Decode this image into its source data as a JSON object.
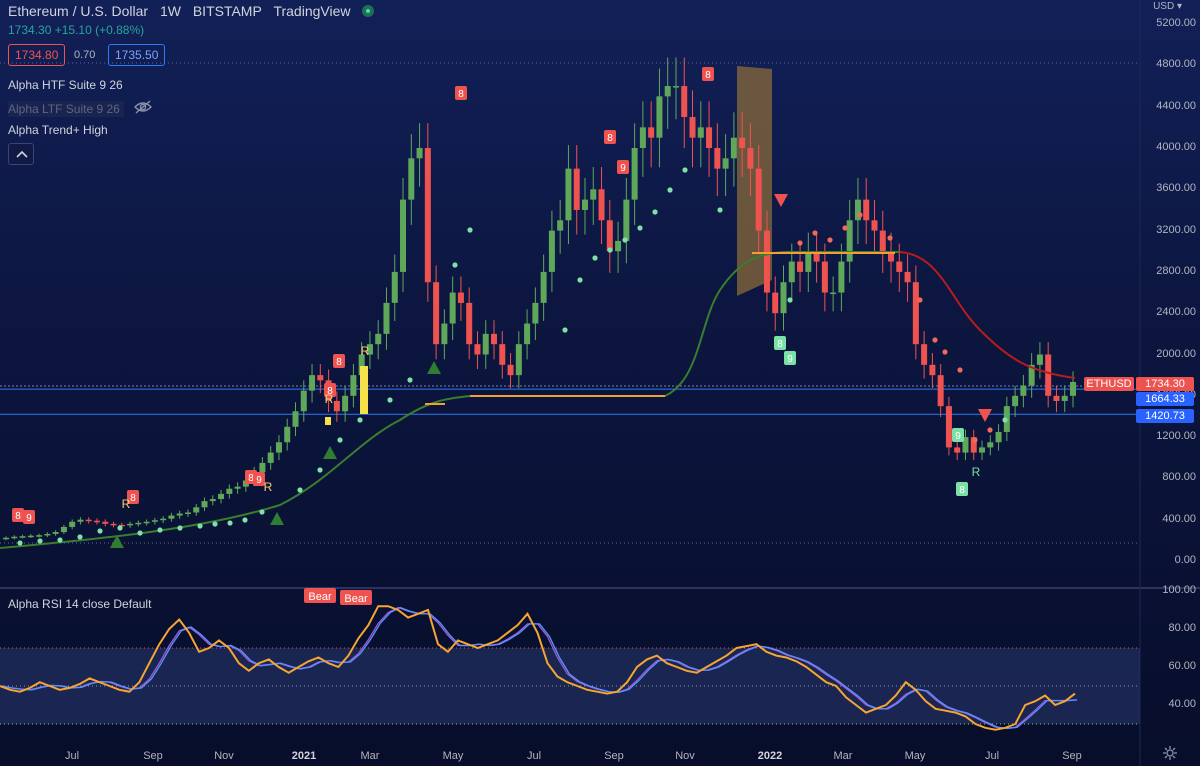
{
  "header": {
    "symbol_name": "Ethereum / U.S. Dollar",
    "interval": "1W",
    "exchange": "BITSTAMP",
    "source": "TradingView",
    "price_change": "1734.30 +15.10 (+0.88%)",
    "bid": "1734.80",
    "spread": "0.70",
    "ask": "1735.50"
  },
  "indicators": {
    "htf": "Alpha HTF Suite 9 26",
    "ltf": "Alpha LTF Suite 9 26",
    "trend": "Alpha Trend+ High",
    "rsi": "Alpha RSI 14 close Default"
  },
  "price_axis": {
    "currency": "USD",
    "labels": [
      "5200.00",
      "4800.00",
      "4400.00",
      "4000.00",
      "3600.00",
      "3200.00",
      "2800.00",
      "2400.00",
      "2000.00",
      "1600.00",
      "1200.00",
      "800.00",
      "400.00",
      "0.00"
    ],
    "values": [
      5200,
      4800,
      4400,
      4000,
      3600,
      3200,
      2800,
      2400,
      2000,
      1600,
      1200,
      800,
      400,
      0
    ]
  },
  "rsi_axis": {
    "labels": [
      "100.00",
      "80.00",
      "60.00",
      "40.00"
    ],
    "values": [
      100,
      80,
      60,
      40
    ]
  },
  "time_axis": {
    "labels": [
      "Jul",
      "Sep",
      "Nov",
      "2021",
      "Mar",
      "May",
      "Jul",
      "Sep",
      "Nov",
      "2022",
      "Mar",
      "May",
      "Jul",
      "Sep"
    ],
    "bold": [
      false,
      false,
      false,
      true,
      false,
      false,
      false,
      false,
      false,
      true,
      false,
      false,
      false,
      false
    ]
  },
  "price_tags": {
    "symbol": "ETHUSD",
    "last": "1734.30",
    "level1": "1664.33",
    "level2": "1420.73"
  },
  "colors": {
    "up": "#5fa85a",
    "down": "#ef5350",
    "rsi_orange": "#f7a531",
    "rsi_blue": "#5b8ff9",
    "trend_green": "#3a7d2e",
    "trend_red": "#b71c1c",
    "level_orange": "#f0a030",
    "hline_blue": "#3179f5"
  },
  "markers": {
    "bear_label": "Bear",
    "count_8": "8",
    "count_9": "9",
    "reversal": "R"
  },
  "chart_data": {
    "type": "candlestick",
    "interval": "1W",
    "price_series": {
      "name": "ETHUSD",
      "approx_closes": [
        225,
        235,
        240,
        245,
        250,
        262,
        280,
        330,
        380,
        400,
        390,
        380,
        360,
        350,
        345,
        360,
        370,
        380,
        395,
        410,
        440,
        460,
        470,
        520,
        580,
        600,
        650,
        700,
        720,
        780,
        860,
        950,
        1050,
        1150,
        1300,
        1450,
        1650,
        1800,
        1750,
        1550,
        1450,
        1600,
        1800,
        2000,
        2100,
        2200,
        2500,
        2800,
        3500,
        3900,
        4000,
        2700,
        2100,
        2300,
        2600,
        2500,
        2100,
        2000,
        2200,
        2100,
        1900,
        1800,
        2100,
        2300,
        2500,
        2800,
        3200,
        3300,
        3800,
        3400,
        3500,
        3600,
        3300,
        3000,
        3100,
        3500,
        4000,
        4200,
        4100,
        4500,
        4600,
        4600,
        4300,
        4100,
        4200,
        4000,
        3800,
        3900,
        4100,
        4000,
        3800,
        3200,
        2600,
        2400,
        2700,
        2900,
        2800,
        3000,
        2900,
        2600,
        2600,
        2900,
        3300,
        3500,
        3300,
        3200,
        3000,
        2900,
        2800,
        2700,
        2100,
        1900,
        1800,
        1500,
        1100,
        1050,
        1200,
        1050,
        1100,
        1150,
        1250,
        1500,
        1600,
        1700,
        1900,
        2000,
        1600,
        1550,
        1600,
        1734
      ]
    },
    "last_price": 1734.3,
    "horizontal_levels": [
      1664.33,
      1420.73,
      1588
    ],
    "rsi": {
      "name": "Alpha RSI 14 close Default",
      "values": [
        50,
        48,
        47,
        49,
        52,
        50,
        48,
        49,
        51,
        54,
        52,
        50,
        48,
        47,
        52,
        62,
        72,
        80,
        85,
        78,
        68,
        70,
        74,
        70,
        62,
        58,
        62,
        64,
        60,
        57,
        60,
        63,
        65,
        62,
        60,
        66,
        75,
        82,
        92,
        92,
        90,
        86,
        88,
        90,
        72,
        68,
        74,
        72,
        70,
        72,
        74,
        78,
        82,
        88,
        78,
        62,
        55,
        52,
        50,
        48,
        47,
        46,
        47,
        52,
        60,
        64,
        66,
        62,
        60,
        58,
        57,
        60,
        63,
        66,
        70,
        71,
        72,
        68,
        66,
        65,
        63,
        60,
        56,
        52,
        50,
        44,
        40,
        36,
        38,
        40,
        45,
        52,
        48,
        42,
        38,
        37,
        36,
        34,
        30,
        28,
        27,
        28,
        30,
        40,
        42,
        45,
        40,
        42,
        46
      ],
      "levels": [
        70,
        50,
        30
      ]
    }
  }
}
